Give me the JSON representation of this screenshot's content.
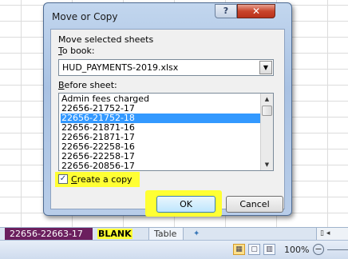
{
  "dialog": {
    "title": "Move or Copy",
    "help_symbol": "?",
    "close_symbol": "✕",
    "move_selected_label": "Move selected sheets",
    "to_book_label_prefix": "",
    "to_book_label_underlined": "T",
    "to_book_label_rest": "o book:",
    "to_book_value": "HUD_PAYMENTS-2019.xlsx",
    "before_sheet_underlined": "B",
    "before_sheet_rest": "efore sheet:",
    "sheets": [
      "Admin fees charged",
      "22656-21752-17",
      "22656-21752-18",
      "22656-21871-16",
      "22656-21871-17",
      "22656-22258-16",
      "22656-22258-17",
      "22656-20856-17"
    ],
    "selected_index": 2,
    "create_copy_checked_mark": "✓",
    "create_copy_underlined": "C",
    "create_copy_rest": "reate a copy",
    "ok_label": "OK",
    "cancel_label": "Cancel"
  },
  "tabs": {
    "dark_tab": "22656-22663-17",
    "blank_tab": "BLANK",
    "table_tab": "Table",
    "nav": "▯ ◂"
  },
  "statusbar": {
    "zoom": "100%",
    "zoom_out": "−"
  },
  "colors": {
    "highlight": "#ffff33",
    "selection": "#3399ff",
    "dark_tab": "#6b1f5e"
  }
}
